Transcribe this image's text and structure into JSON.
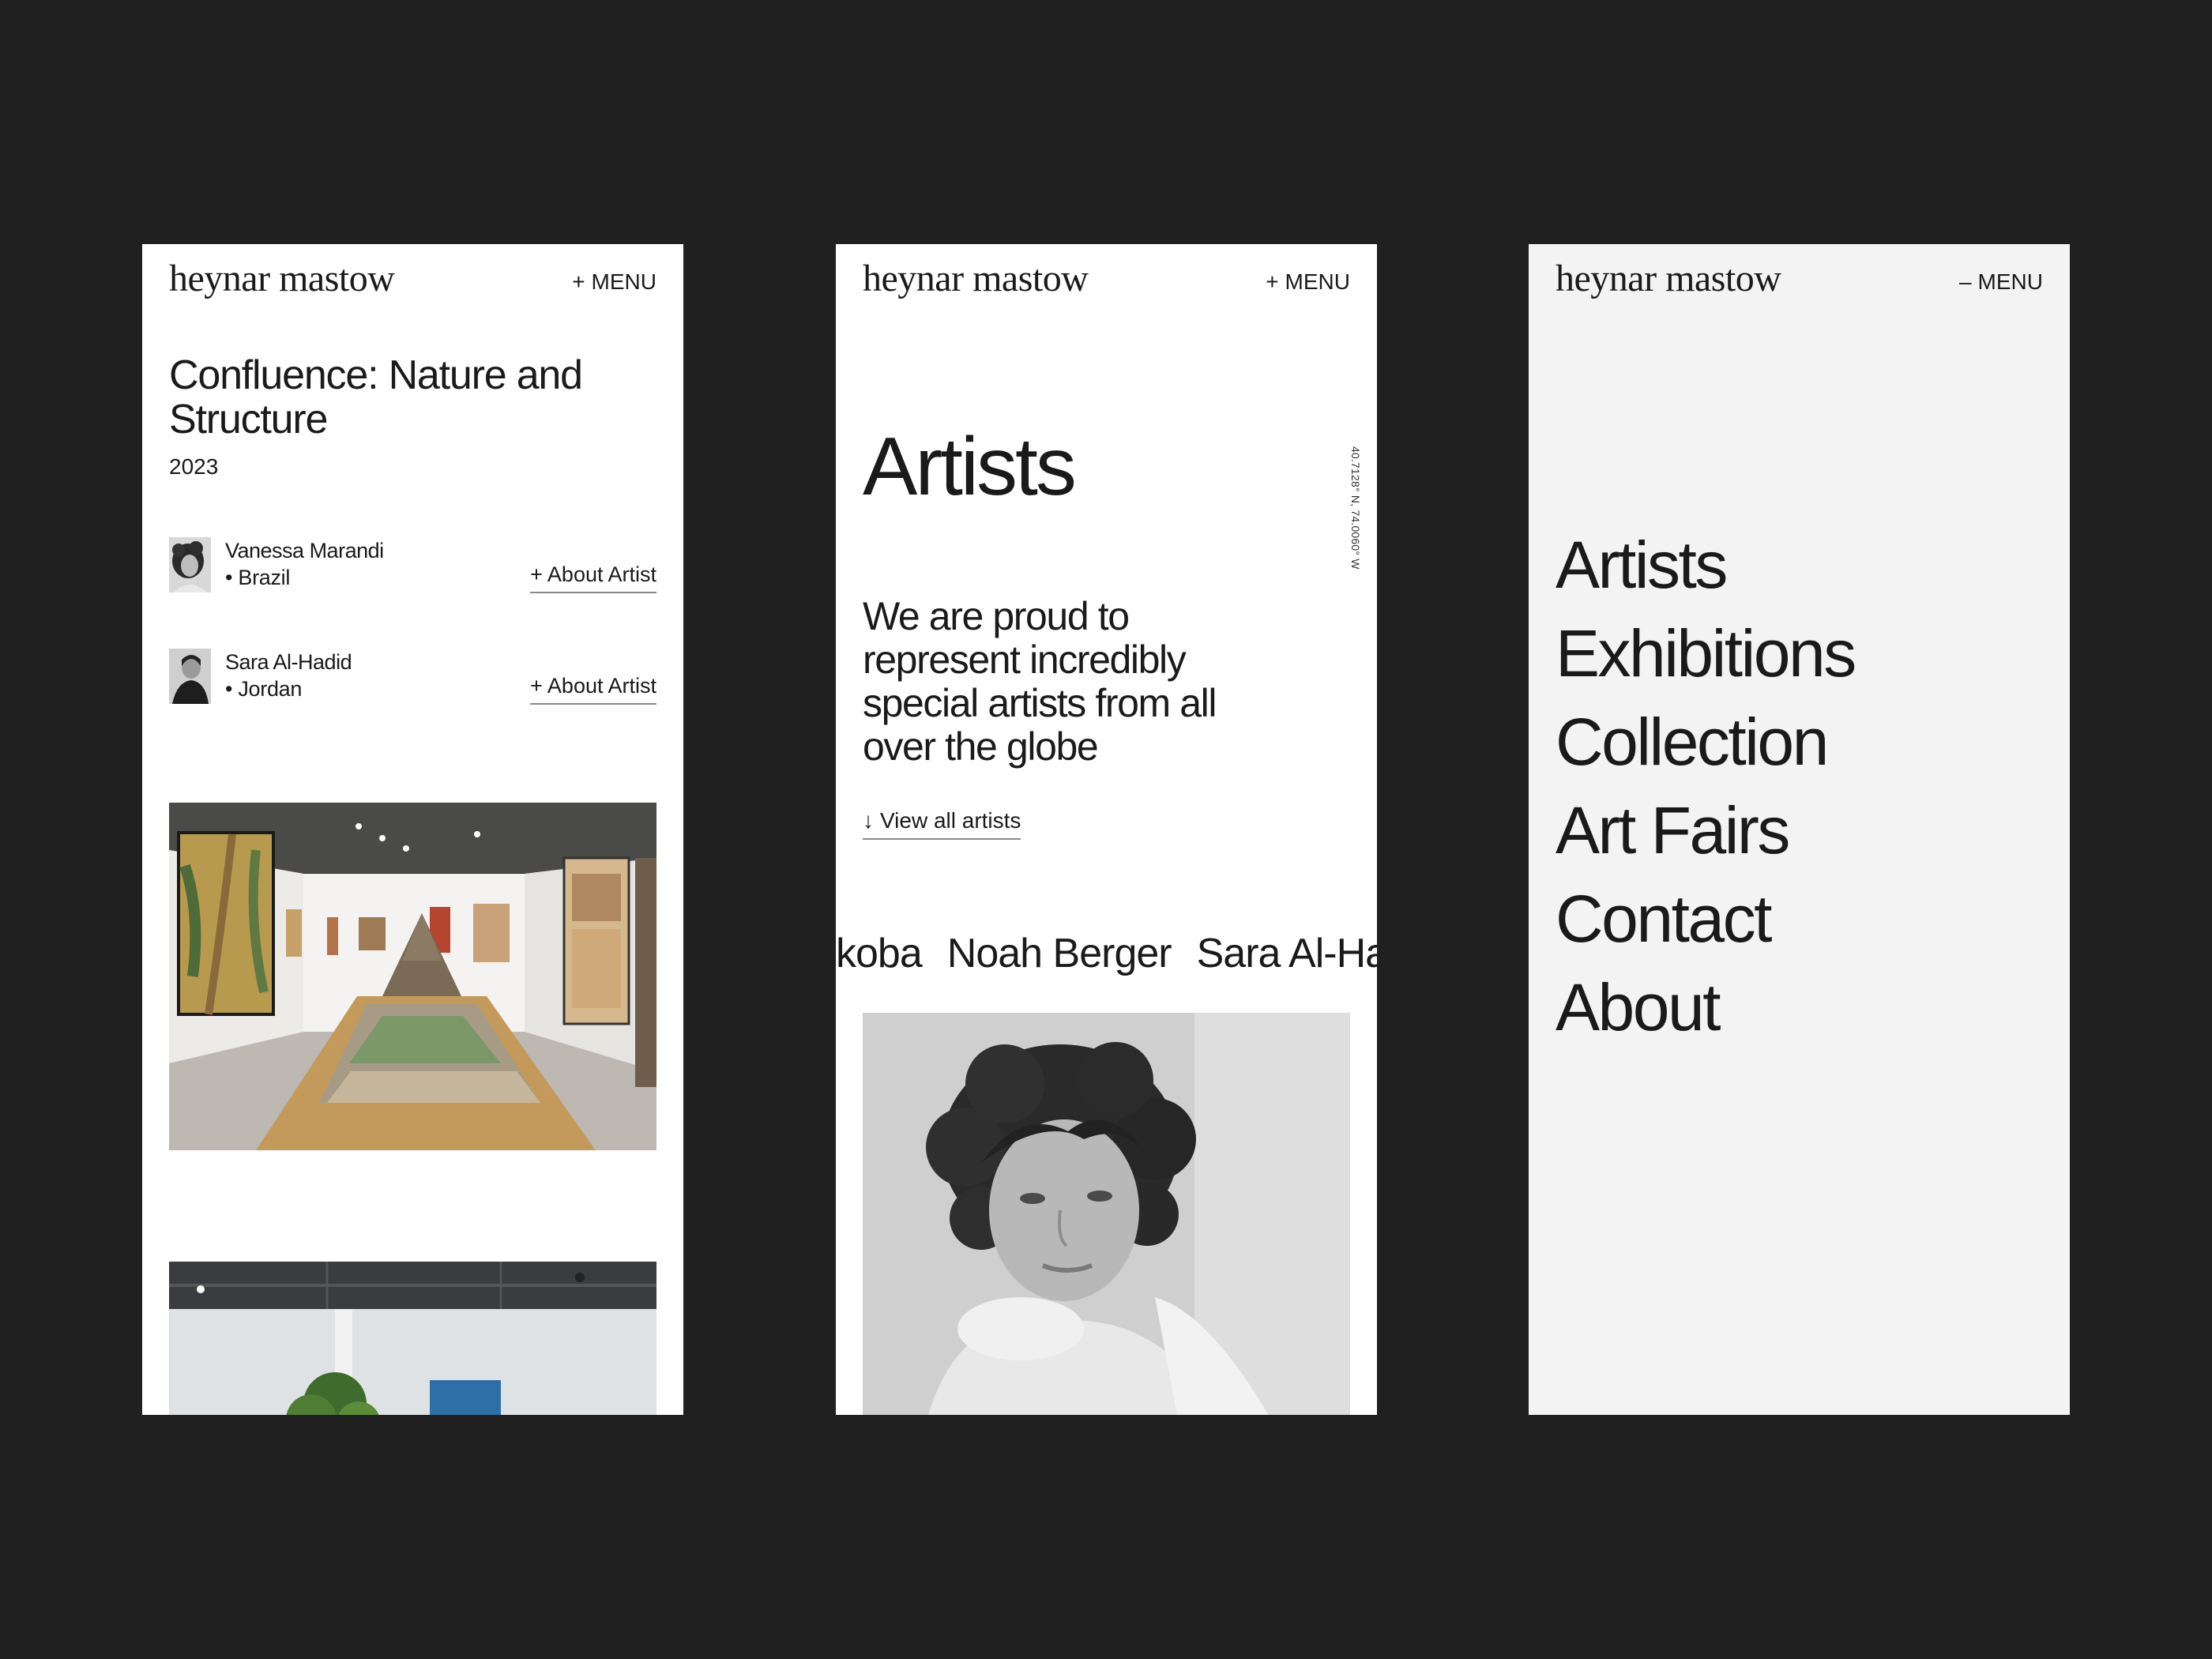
{
  "brand": "heynar mastow",
  "exhibition_screen": {
    "menu_symbol": "+",
    "menu_label": "MENU",
    "title": "Confluence: Nature and Structure",
    "year": "2023",
    "artists": [
      {
        "name": "Vanessa Marandi",
        "country": "• Brazil",
        "link": "+ About Artist"
      },
      {
        "name": "Sara Al-Hadid",
        "country": "• Jordan",
        "link": "+ About Artist"
      }
    ]
  },
  "artists_screen": {
    "menu_symbol": "+",
    "menu_label": "MENU",
    "heading": "Artists",
    "coordinates": "40.7128° N, 74.0060° W",
    "intro": "We are proud to represent incredibly special artists from all over the globe",
    "view_all_arrow": "↓",
    "view_all": "View all artists",
    "ticker": [
      "koba",
      "Noah Berger",
      "Sara Al-Ha"
    ]
  },
  "menu_screen": {
    "menu_symbol": "–",
    "menu_label": "MENU",
    "items": [
      "Artists",
      "Exhibitions",
      "Collection",
      "Art Fairs",
      "Contact",
      "About"
    ]
  },
  "colors": {
    "backdrop": "#202020",
    "page": "#ffffff",
    "menu_page": "#f3f3f3",
    "text": "#1a1a1a"
  }
}
